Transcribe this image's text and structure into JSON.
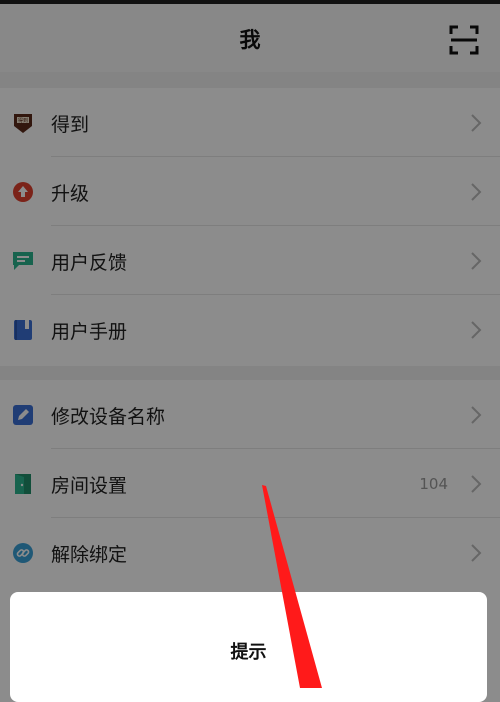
{
  "header": {
    "title": "我"
  },
  "menu": [
    {
      "label": "得到",
      "icon": "dedao-logo-icon",
      "value": ""
    },
    {
      "label": "升级",
      "icon": "upgrade-arrow-icon",
      "value": ""
    },
    {
      "label": "用户反馈",
      "icon": "feedback-message-icon",
      "value": ""
    },
    {
      "label": "用户手册",
      "icon": "manual-book-icon",
      "value": ""
    },
    {
      "label": "修改设备名称",
      "icon": "edit-pencil-icon",
      "value": ""
    },
    {
      "label": "房间设置",
      "icon": "door-icon",
      "value": "104"
    },
    {
      "label": "解除绑定",
      "icon": "unlink-icon",
      "value": ""
    }
  ],
  "dialog": {
    "title": "提示"
  },
  "colors": {
    "accent_red": "#e0412f",
    "feedback_green": "#2bb58e",
    "blue": "#3b6fd6",
    "annotation_red": "#ff1a1a"
  }
}
